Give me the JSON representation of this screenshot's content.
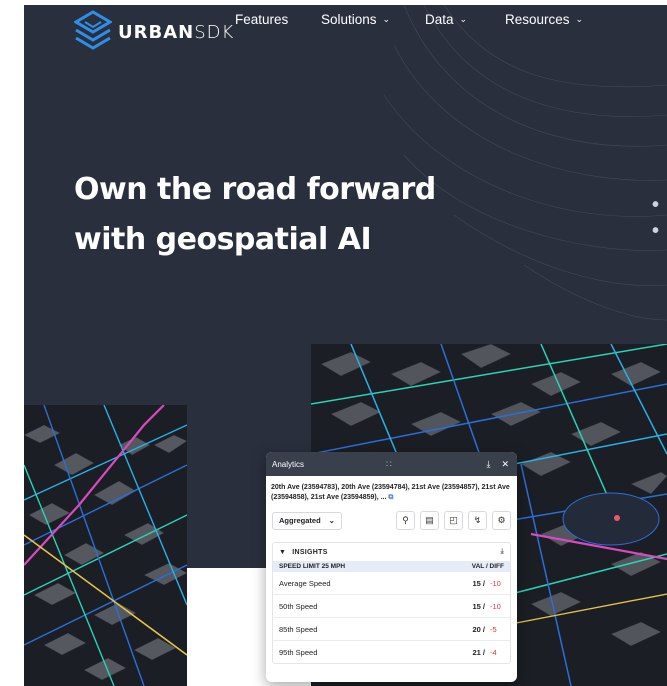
{
  "brand": {
    "name_bold": "URBAN",
    "name_light": "SDK"
  },
  "nav": [
    {
      "label": "Features",
      "chevron": false
    },
    {
      "label": "Solutions",
      "chevron": true
    },
    {
      "label": "Data",
      "chevron": true
    },
    {
      "label": "Resources",
      "chevron": true
    }
  ],
  "hero": {
    "line1": "Own the road forward",
    "line2": "with geospatial AI"
  },
  "analytics": {
    "title": "Analytics",
    "segments": "20th Ave (23594783), 20th Ave (23594784), 21st Ave (23594857), 21st Ave (23594858), 21st Ave (23594859), ...",
    "mode": "Aggregated",
    "insights_label": "INSIGHTS",
    "speed_limit": "SPEED LIMIT  25 MPH",
    "val_diff": "VAL  /  DIFF",
    "metrics": [
      {
        "name": "Average Speed",
        "val": "15",
        "diff": "-10"
      },
      {
        "name": "50th Speed",
        "val": "15",
        "diff": "-10"
      },
      {
        "name": "85th Speed",
        "val": "20",
        "diff": "-5"
      },
      {
        "name": "95th Speed",
        "val": "21",
        "diff": "-4"
      }
    ]
  },
  "colors": {
    "hero_bg": "#2a2f3d",
    "accent_blue": "#2f8fe8",
    "negative": "#d33a3a"
  }
}
